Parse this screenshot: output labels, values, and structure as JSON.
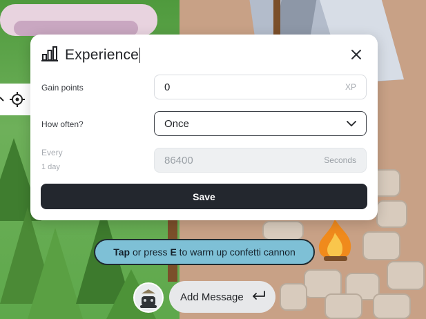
{
  "modal": {
    "title": "Experience",
    "fields": {
      "gain_points": {
        "label": "Gain points",
        "value": "0",
        "suffix": "XP"
      },
      "how_often": {
        "label": "How often?",
        "value": "Once"
      },
      "every": {
        "label": "Every",
        "sublabel": "1 day",
        "value": "86400",
        "suffix": "Seconds"
      }
    },
    "save_label": "Save"
  },
  "prompt": {
    "parts": [
      "Tap",
      " or press ",
      "E",
      " to warm up confetti cannon"
    ]
  },
  "chat": {
    "add_message_label": "Add Message"
  },
  "icons": [
    "bar-chart-icon",
    "close-icon",
    "chevron-down-icon",
    "target-icon",
    "return-icon",
    "avatar"
  ],
  "colors": {
    "save_button": "#23272e",
    "prompt_bg": "#7ec0d6",
    "modal_bg": "#ffffff"
  }
}
